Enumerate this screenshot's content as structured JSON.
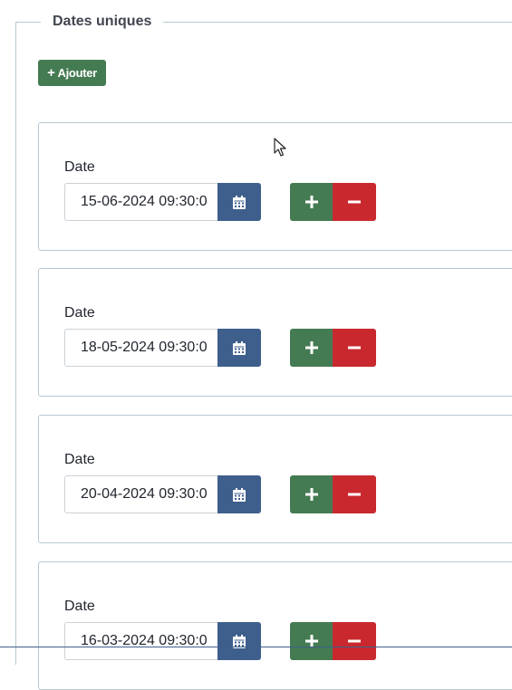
{
  "section": {
    "legend": "Dates uniques",
    "add_button_label": "Ajouter"
  },
  "field_label": "Date",
  "entries": [
    {
      "label": "Date",
      "value": "15-06-2024 09:30:0"
    },
    {
      "label": "Date",
      "value": "18-05-2024 09:30:0"
    },
    {
      "label": "Date",
      "value": "20-04-2024 09:30:0"
    },
    {
      "label": "Date",
      "value": "16-03-2024 09:30:0"
    }
  ],
  "colors": {
    "add": "#457b52",
    "calendar": "#3e5f8c",
    "remove": "#c9292e",
    "border": "#b8c8d0"
  },
  "icons": {
    "add": "plus-icon",
    "calendar": "calendar-icon",
    "remove": "minus-icon"
  }
}
